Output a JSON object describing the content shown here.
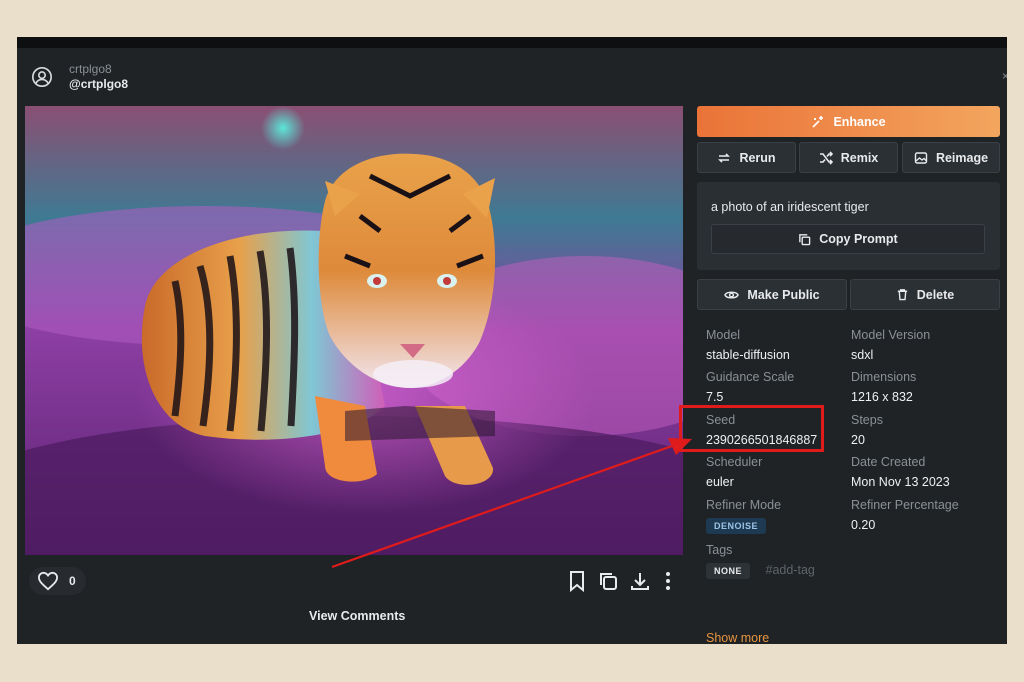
{
  "user": {
    "username": "crtplgo8",
    "handle": "@crtplgo8",
    "avatar_icon": "user-circle-icon"
  },
  "image": {
    "subject": "iridescent tiger"
  },
  "footer": {
    "like_count": "0",
    "view_comments": "View Comments"
  },
  "actions": {
    "enhance": "Enhance",
    "rerun": "Rerun",
    "remix": "Remix",
    "reimage": "Reimage",
    "make_public": "Make Public",
    "delete": "Delete",
    "copy_prompt": "Copy Prompt"
  },
  "prompt": "a photo of an iridescent tiger",
  "details": {
    "model_label": "Model",
    "model": "stable-diffusion",
    "model_version_label": "Model Version",
    "model_version": "sdxl",
    "guidance_label": "Guidance Scale",
    "guidance": "7.5",
    "dimensions_label": "Dimensions",
    "dimensions": "1216 x 832",
    "seed_label": "Seed",
    "seed": "2390266501846887",
    "steps_label": "Steps",
    "steps": "20",
    "scheduler_label": "Scheduler",
    "scheduler": "euler",
    "date_label": "Date Created",
    "date": "Mon Nov 13 2023",
    "refiner_mode_label": "Refiner Mode",
    "refiner_mode": "DENOISE",
    "refiner_pct_label": "Refiner Percentage",
    "refiner_pct": "0.20",
    "tags_label": "Tags",
    "tag_none": "NONE",
    "tag_add": "#add-tag",
    "show_more": "Show more"
  },
  "colors": {
    "accent": "#ea7338",
    "highlight": "#e01b1b",
    "background": "#1f2326",
    "page": "#e9dfcb"
  }
}
